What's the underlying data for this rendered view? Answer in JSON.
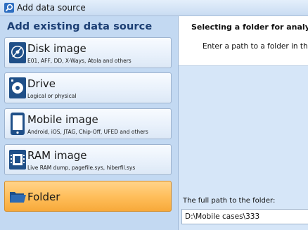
{
  "window": {
    "title": "Add data source",
    "icon": "magnifier-icon"
  },
  "left_panel": {
    "heading": "Add existing data source",
    "sources": [
      {
        "title": "Disk image",
        "subtitle": "E01, AFF, DD, X-Ways, Atola and others",
        "icon": "disk-image-icon",
        "selected": false
      },
      {
        "title": "Drive",
        "subtitle": "Logical or physical",
        "icon": "drive-icon",
        "selected": false
      },
      {
        "title": "Mobile image",
        "subtitle": "Android, iOS, JTAG, Chip-Off, UFED and others",
        "icon": "mobile-phone-icon",
        "selected": false
      },
      {
        "title": "RAM image",
        "subtitle": "Live RAM dump, pagefile.sys, hiberfil.sys",
        "icon": "ram-chip-icon",
        "selected": false
      },
      {
        "title": "Folder",
        "subtitle": "",
        "icon": "folder-icon",
        "selected": true
      }
    ]
  },
  "right_panel": {
    "heading": "Selecting a folder for analysis",
    "description": "Enter a path to a folder in the",
    "path_label": "The full path to the folder:",
    "path_value": "D:\\Mobile cases\\333"
  },
  "colors": {
    "left_bg": "#c3d9f2",
    "selected_accent": "#ffbf5c",
    "heading_text": "#1c3f74",
    "right_bg": "#d6e6f8"
  }
}
